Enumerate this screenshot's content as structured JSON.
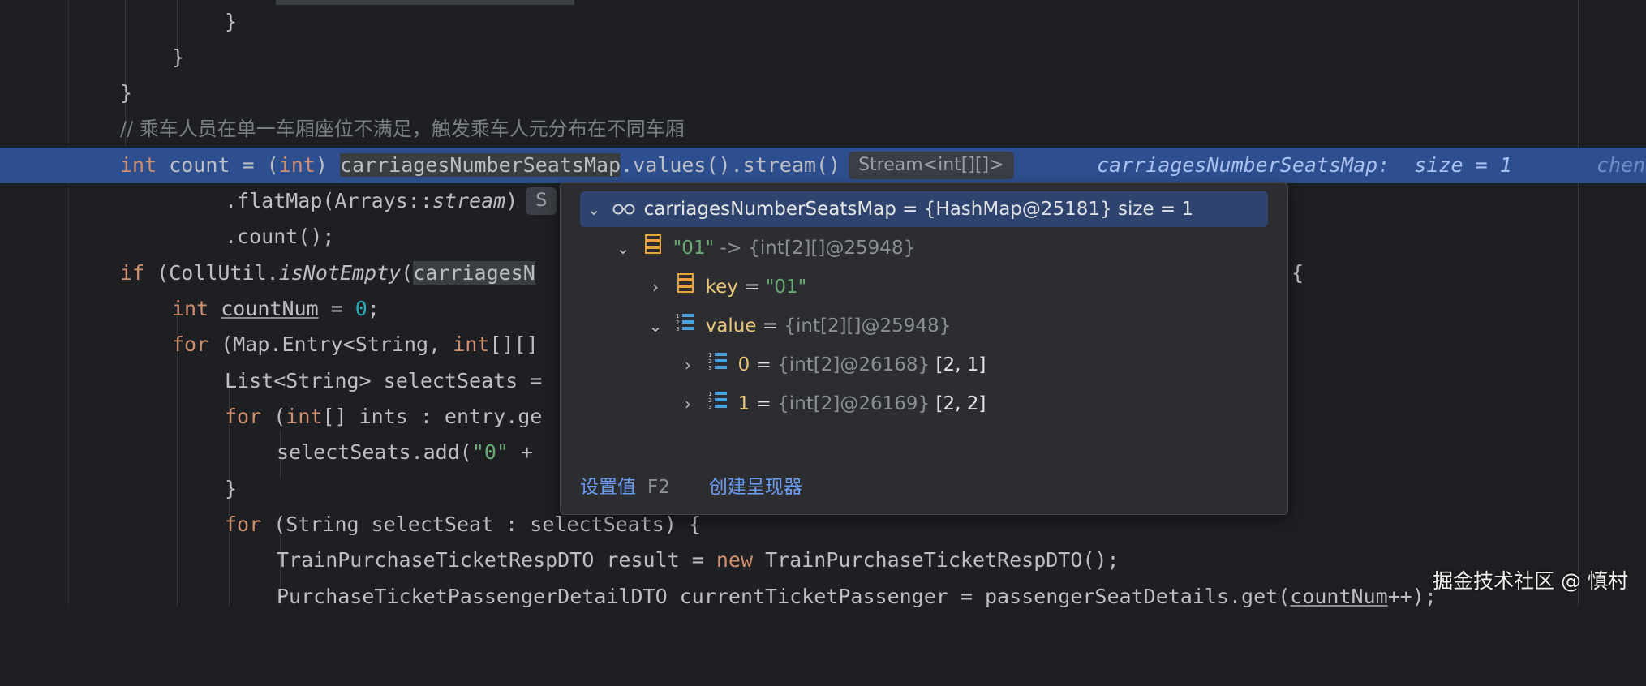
{
  "code": {
    "line_close_inner": "}",
    "line_close_mid": "}",
    "line_close_outer": "}",
    "comment": "// 乘车人员在单一车厢座位不满足，触发乘车人元分布在不同车厢",
    "l_int": "int",
    "l_count": " count = (",
    "l_int2": "int",
    "l_paren": ") ",
    "l_map": "carriagesNumberSeatsMap",
    "l_stream": ".values().stream()",
    "hint_stream": "Stream<int[][]>",
    "inline_var": "carriagesNumberSeatsMap:",
    "inline_size": "size = 1",
    "inline_more": "chen",
    "flatmap_a": ".flatMap(Arrays::",
    "flatmap_b": "stream",
    "flatmap_c": ")",
    "flatmap_hint": "S",
    "count_call": ".count();",
    "if_kw": "if",
    "if_a": " (CollUtil.",
    "if_b": "isNotEmpty",
    "if_c": "(",
    "if_d": "carriagesN",
    "if_end": "{",
    "cn_int": "int",
    "cn_var": "countNum",
    "cn_eq": " = ",
    "cn_zero": "0",
    "cn_end": ";",
    "for1_kw": "for",
    "for1_a": " (Map.Entry<String, ",
    "for1_int": "int",
    "for1_b": "[][]",
    "list_line": "List<String> selectSeats =",
    "for2_kw": "for",
    "for2_a": " (",
    "for2_int": "int",
    "for2_b": "[] ints : entry.ge",
    "add_a": "selectSeats.add(",
    "add_str": "\"0\"",
    "add_b": " +",
    "close_for2": "}",
    "for3_kw": "for",
    "for3_a": " (String selectSeat : selectSeats) {",
    "resp_a": "TrainPurchaseTicketRespDTO result = ",
    "resp_new": "new",
    "resp_b": " TrainPurchaseTicketRespDTO();",
    "passenger_a": "PurchaseTicketPassengerDetailDTO currentTicketPassenger = passengerSeatDetails.get(",
    "passenger_var": "countNum",
    "passenger_b": "++);"
  },
  "debug_popup": {
    "root_name": "carriagesNumberSeatsMap",
    "root_value": " = {HashMap@25181}  size = 1",
    "entry_key": "\"01\"",
    "entry_arrow": " -> ",
    "entry_ref": "{int[2][]@25948}",
    "key_label": "key",
    "key_eq": " = ",
    "key_value": "\"01\"",
    "value_label": "value",
    "value_eq": " = ",
    "value_ref": "{int[2][]@25948}",
    "item0_label": "0",
    "item0_eq": " = ",
    "item0_ref": "{int[2]@26168}",
    "item0_val": " [2, 1]",
    "item1_label": "1",
    "item1_eq": " = ",
    "item1_ref": "{int[2]@26169}",
    "item1_val": " [2, 2]",
    "set_value_label": "设置值",
    "set_value_shortcut": "F2",
    "create_renderer_label": "创建呈现器"
  },
  "watermark": "掘金技术社区 @ 慎村",
  "colors": {
    "background": "#1e1f22",
    "current_line": "#2e4f8f",
    "keyword": "#cf8e6d",
    "string": "#6aab73",
    "number": "#2aacb8",
    "link": "#6c9cf0"
  }
}
